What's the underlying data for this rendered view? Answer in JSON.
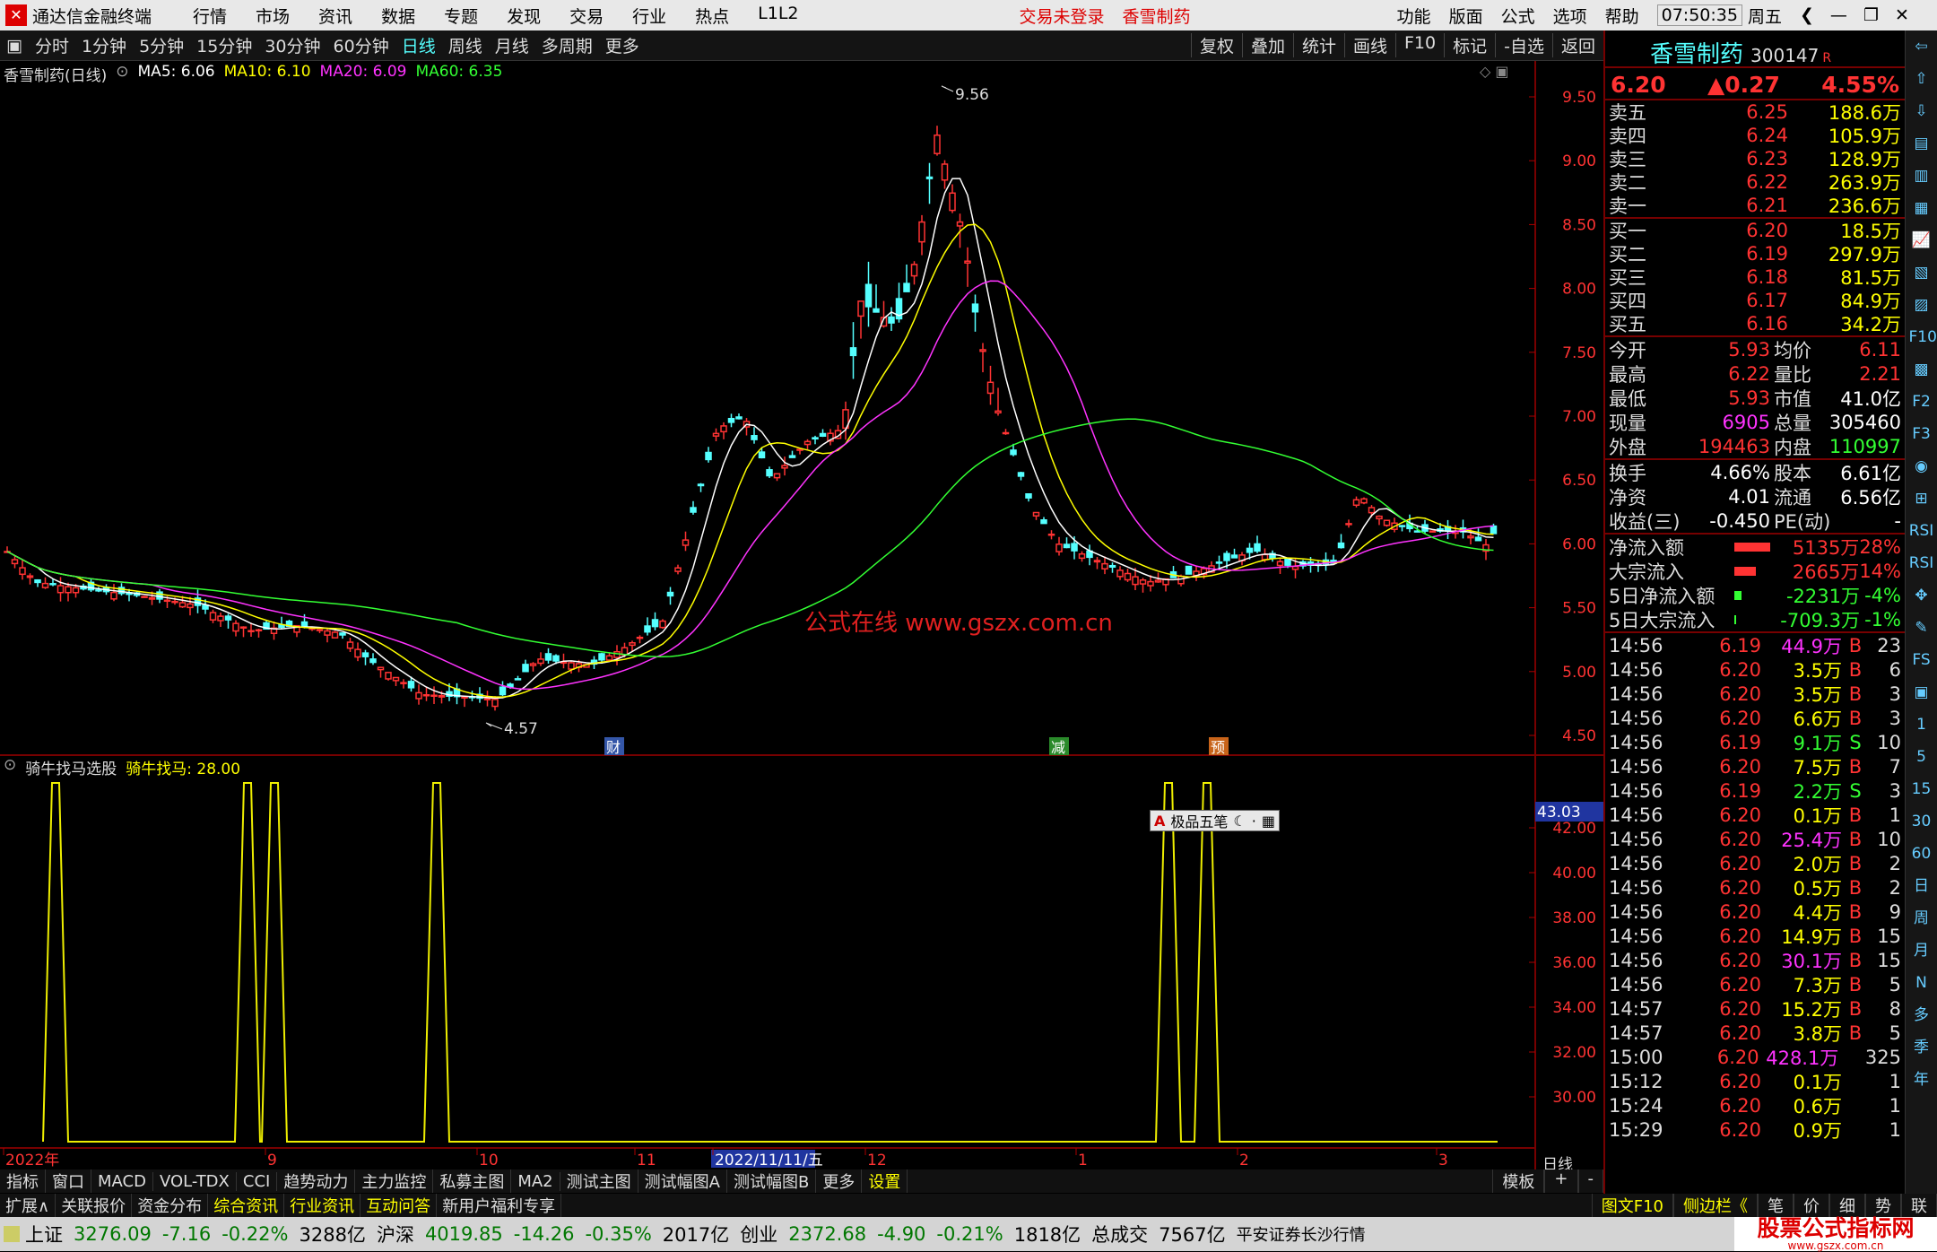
{
  "app": {
    "title": "通达信金融终端",
    "menus": [
      "行情",
      "市场",
      "资讯",
      "数据",
      "专题",
      "发现",
      "交易",
      "行业",
      "热点",
      "L1L2"
    ],
    "login": "交易未登录",
    "stock_top": "香雪制药",
    "right_menus": [
      "功能",
      "版面",
      "公式",
      "选项",
      "帮助"
    ],
    "time": "07:50:35",
    "weekday": "周五"
  },
  "periods": [
    "分时",
    "1分钟",
    "5分钟",
    "15分钟",
    "30分钟",
    "60分钟",
    "日线",
    "周线",
    "月线",
    "多周期",
    "更多"
  ],
  "tools": [
    "复权",
    "叠加",
    "统计",
    "画线",
    "F10",
    "标记",
    "-自选",
    "返回"
  ],
  "ma": {
    "name": "香雪制药(日线)",
    "ma5": "MA5: 6.06",
    "ma10": "MA10: 6.10",
    "ma20": "MA20: 6.09",
    "ma60": "MA60: 6.35"
  },
  "annot": {
    "high": "9.56",
    "low": "4.57",
    "watermark": "公式在线  www.gszx.com.cn",
    "cai": "财",
    "jian": "减",
    "yu": "预"
  },
  "price_axis": [
    "9.50",
    "9.00",
    "8.50",
    "8.00",
    "7.50",
    "7.00",
    "6.50",
    "6.00",
    "5.50",
    "5.00",
    "4.50"
  ],
  "ind": {
    "name": "骑牛找马选股",
    "value": "骑牛找马: 28.00",
    "axis": [
      "42.00",
      "40.00",
      "38.00",
      "36.00",
      "34.00",
      "32.00",
      "30.00"
    ],
    "cur": "43.03",
    "ime": "极品五笔"
  },
  "dates": [
    "2022年",
    "9",
    "10",
    "11",
    "2022/11/11/五",
    "12",
    "1",
    "2",
    "3"
  ],
  "period_label": "日线",
  "quote": {
    "name": "香雪制药",
    "code": "300147",
    "r": "R",
    "price": "6.20",
    "change": "▲0.27",
    "pct": "4.55%",
    "asks": [
      [
        "卖五",
        "6.25",
        "188.6万"
      ],
      [
        "卖四",
        "6.24",
        "105.9万"
      ],
      [
        "卖三",
        "6.23",
        "128.9万"
      ],
      [
        "卖二",
        "6.22",
        "263.9万"
      ],
      [
        "卖一",
        "6.21",
        "236.6万"
      ]
    ],
    "bids": [
      [
        "买一",
        "6.20",
        "18.5万"
      ],
      [
        "买二",
        "6.19",
        "297.9万"
      ],
      [
        "买三",
        "6.18",
        "81.5万"
      ],
      [
        "买四",
        "6.17",
        "84.9万"
      ],
      [
        "买五",
        "6.16",
        "34.2万"
      ]
    ],
    "stats": [
      [
        "今开",
        "5.93",
        "均价",
        "6.11"
      ],
      [
        "最高",
        "6.22",
        "量比",
        "2.21"
      ],
      [
        "最低",
        "5.93",
        "市值",
        "41.0亿"
      ],
      [
        "现量",
        "6905",
        "总量",
        "305460"
      ],
      [
        "外盘",
        "194463",
        "内盘",
        "110997"
      ]
    ],
    "stats2": [
      [
        "换手",
        "4.66%",
        "股本",
        "6.61亿"
      ],
      [
        "净资",
        "4.01",
        "流通",
        "6.56亿"
      ],
      [
        "收益(三)",
        "-0.450",
        "PE(动)",
        "-"
      ]
    ],
    "flows": [
      [
        "净流入额",
        "5135万",
        "28%"
      ],
      [
        "大宗流入",
        "2665万",
        "14%"
      ],
      [
        "5日净流入额",
        "-2231万",
        "-4%"
      ],
      [
        "5日大宗流入",
        "-709.3万",
        "-1%"
      ]
    ],
    "ticks": [
      [
        "14:56",
        "6.19",
        "44.9万",
        "B",
        "23"
      ],
      [
        "14:56",
        "6.20",
        "3.5万",
        "B",
        "6"
      ],
      [
        "14:56",
        "6.20",
        "3.5万",
        "B",
        "3"
      ],
      [
        "14:56",
        "6.20",
        "6.6万",
        "B",
        "3"
      ],
      [
        "14:56",
        "6.19",
        "9.1万",
        "S",
        "10"
      ],
      [
        "14:56",
        "6.20",
        "7.5万",
        "B",
        "7"
      ],
      [
        "14:56",
        "6.19",
        "2.2万",
        "S",
        "3"
      ],
      [
        "14:56",
        "6.20",
        "0.1万",
        "B",
        "1"
      ],
      [
        "14:56",
        "6.20",
        "25.4万",
        "B",
        "10"
      ],
      [
        "14:56",
        "6.20",
        "2.0万",
        "B",
        "2"
      ],
      [
        "14:56",
        "6.20",
        "0.5万",
        "B",
        "2"
      ],
      [
        "14:56",
        "6.20",
        "4.4万",
        "B",
        "9"
      ],
      [
        "14:56",
        "6.20",
        "14.9万",
        "B",
        "15"
      ],
      [
        "14:56",
        "6.20",
        "30.1万",
        "B",
        "15"
      ],
      [
        "14:56",
        "6.20",
        "7.3万",
        "B",
        "5"
      ],
      [
        "14:57",
        "6.20",
        "15.2万",
        "B",
        "8"
      ],
      [
        "14:57",
        "6.20",
        "3.8万",
        "B",
        "5"
      ],
      [
        "15:00",
        "6.20",
        "428.1万",
        "",
        "325"
      ],
      [
        "15:12",
        "6.20",
        "0.1万",
        "",
        "1"
      ],
      [
        "15:24",
        "6.20",
        "0.6万",
        "",
        "1"
      ],
      [
        "15:29",
        "6.20",
        "0.9万",
        "",
        "1"
      ]
    ]
  },
  "sidebar": [
    "⇦",
    "⇧",
    "⇩",
    "▤",
    "▥",
    "▦",
    "📈",
    "▧",
    "▨",
    "F10",
    "▩",
    "F2",
    "F3",
    "◉",
    "⊞",
    "RSI",
    "RSI",
    "✥",
    "✎",
    "FS",
    "▣",
    "1",
    "5",
    "15",
    "30",
    "60",
    "日",
    "周",
    "月",
    "N",
    "多",
    "季",
    "年"
  ],
  "bottom": [
    "指标",
    "窗口",
    "MACD",
    "VOL-TDX",
    "CCI",
    "趋势动力",
    "主力监控",
    "私募主图",
    "MA2",
    "测试主图",
    "测试幅图A",
    "测试幅图B",
    "更多",
    "设置"
  ],
  "bottom_right": [
    "模板",
    "+",
    "-"
  ],
  "tabs": [
    "扩展∧",
    "关联报价",
    "资金分布",
    "综合资讯",
    "行业资讯",
    "互动问答",
    "新用户福利专享"
  ],
  "tabs_right": [
    "图文F10",
    "侧边栏《",
    "笔",
    "价",
    "细",
    "势",
    "联"
  ],
  "status": {
    "sh": "上证",
    "sh_v": "3276.09",
    "sh_c": "-7.16",
    "sh_p": "-0.22%",
    "sh_a": "3288亿",
    "hs": "沪深",
    "hs_v": "4019.85",
    "hs_c": "-14.26",
    "hs_p": "-0.35%",
    "hs_a": "2017亿",
    "cy": "创业",
    "cy_v": "2372.68",
    "cy_c": "-4.90",
    "cy_p": "-0.21%",
    "cy_a": "1818亿",
    "tot": "总成交",
    "tot_v": "7567亿",
    "broker": "平安证券长沙行情",
    "logo": "股票公式指标网",
    "logo_url": "www.gszx.com.cn"
  }
}
